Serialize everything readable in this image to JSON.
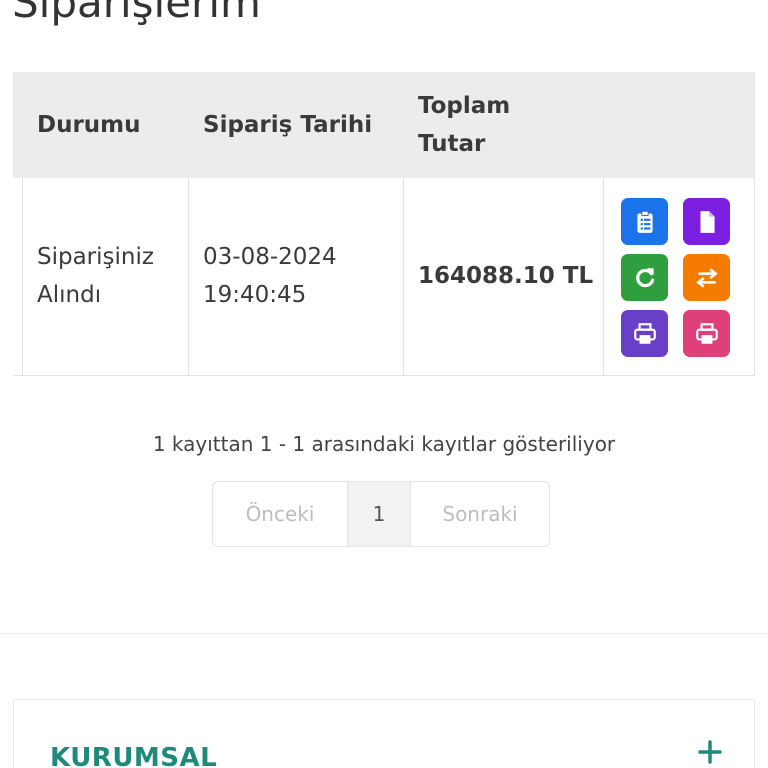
{
  "page": {
    "title": "Siparişlerim"
  },
  "table": {
    "headers": {
      "status": "Durumu",
      "date": "Sipariş Tarihi",
      "total_line1": "Toplam",
      "total_line2": "Tutar"
    },
    "rows": [
      {
        "status_line1": "Siparişiniz",
        "status_line2": "Alındı",
        "date_line1": "03-08-2024",
        "date_line2": "19:40:45",
        "total": "164088.10 TL",
        "actions": [
          {
            "icon": "clipboard-list-icon",
            "color": "#1a73e8"
          },
          {
            "icon": "document-icon",
            "color": "#7b1fe0"
          },
          {
            "icon": "refresh-icon",
            "color": "#2e9e3e"
          },
          {
            "icon": "exchange-icon",
            "color": "#f57c00"
          },
          {
            "icon": "print-icon",
            "color": "#6a3fc7"
          },
          {
            "icon": "print-icon",
            "color": "#e0407a"
          }
        ]
      }
    ]
  },
  "pagination": {
    "info": "1 kayıttan 1 - 1 arasındaki kayıtlar gösteriliyor",
    "prev": "Önceki",
    "current": "1",
    "next": "Sonraki"
  },
  "footer": {
    "section_title": "KURUMSAL",
    "expand_icon": "plus-icon",
    "accent_color": "#1e8a7a"
  }
}
